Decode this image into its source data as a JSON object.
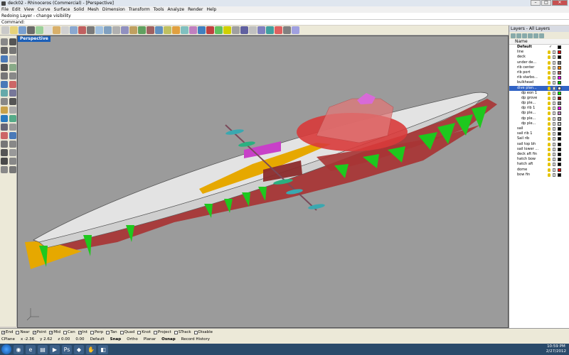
{
  "window": {
    "title": "deck02 - Rhinoceros (Commercial) - [Perspective]"
  },
  "menu": [
    "File",
    "Edit",
    "View",
    "Curve",
    "Surface",
    "Solid",
    "Mesh",
    "Dimension",
    "Transform",
    "Tools",
    "Analyze",
    "Render",
    "Help"
  ],
  "command": {
    "history": "Redoing Layer - change visibility",
    "prompt": "Command:",
    "value": ""
  },
  "viewport": {
    "tab": "Perspective"
  },
  "layers": {
    "title": "Layers - All Layers",
    "column_name": "Name",
    "rows": [
      {
        "name": "Default",
        "check": "✓",
        "color": "#000000",
        "type": "default"
      },
      {
        "name": "line",
        "color": "#ff0000"
      },
      {
        "name": "deck",
        "color": "#000000"
      },
      {
        "name": "under de...",
        "color": "#7d7d7d"
      },
      {
        "name": "rib center",
        "color": "#ff8000"
      },
      {
        "name": "rib port",
        "color": "#b05a5a"
      },
      {
        "name": "rib starbo...",
        "color": "#ff00ff"
      },
      {
        "name": "bulkhead",
        "color": "#00c000"
      },
      {
        "name": "dive plan...",
        "color": "#ffffff",
        "type": "selected"
      },
      {
        "name": "dp eon 1",
        "color": "#00ff00",
        "type": "child"
      },
      {
        "name": "dp grove",
        "color": "#8b0000",
        "type": "child"
      },
      {
        "name": "dp ple...",
        "color": "#7d7d7d",
        "type": "child"
      },
      {
        "name": "dp rib 1",
        "color": "#ff00ff",
        "type": "child"
      },
      {
        "name": "dp ple...",
        "color": "#c080c0",
        "type": "child"
      },
      {
        "name": "dp ple...",
        "color": "#a0a0a0",
        "type": "child"
      },
      {
        "name": "dp ple...",
        "color": "#c0c0c0",
        "type": "child"
      },
      {
        "name": "sail",
        "color": "#000000"
      },
      {
        "name": "sail rib 1",
        "color": "#000000"
      },
      {
        "name": "Sail rib",
        "color": "#000000"
      },
      {
        "name": "sail top bh",
        "color": "#000000"
      },
      {
        "name": "sail lower ...",
        "color": "#000000"
      },
      {
        "name": "deck aft fin",
        "color": "#000000"
      },
      {
        "name": "hatch bow",
        "color": "#000000"
      },
      {
        "name": "hatch aft",
        "color": "#000000"
      },
      {
        "name": "dome",
        "color": "#ff0000"
      },
      {
        "name": "bow fin",
        "color": "#000000"
      }
    ]
  },
  "osnap": [
    {
      "label": "End",
      "checked": true
    },
    {
      "label": "Near",
      "checked": false
    },
    {
      "label": "Point",
      "checked": true
    },
    {
      "label": "Mid",
      "checked": true
    },
    {
      "label": "Cen",
      "checked": false
    },
    {
      "label": "Int",
      "checked": true
    },
    {
      "label": "Perp",
      "checked": false
    },
    {
      "label": "Tan",
      "checked": false
    },
    {
      "label": "Quad",
      "checked": false
    },
    {
      "label": "Knot",
      "checked": false
    },
    {
      "label": "Project",
      "checked": false
    },
    {
      "label": "STrack",
      "checked": false
    },
    {
      "label": "Disable",
      "checked": false
    }
  ],
  "status": {
    "cplane": "CPlane",
    "x": "x -2.36",
    "y": "y 2.62",
    "z": "z 0.00",
    "val": "0.00",
    "layer": "Default",
    "snap": "Snap",
    "ortho": "Ortho",
    "planar": "Planar",
    "osnap": "Osnap",
    "record": "Record History"
  },
  "clock": {
    "time": "10:59 PM",
    "date": "2/27/2012"
  },
  "colors": {
    "hull": "#e3e3e3",
    "hull_stroke": "#555555",
    "ribs": "#b03a3a",
    "fins": "#1ec81e",
    "dome": "#d83a3a",
    "center_rib": "#e6a800",
    "plane_port": "#c040c0",
    "plane_cyan": "#3aa8b0"
  }
}
